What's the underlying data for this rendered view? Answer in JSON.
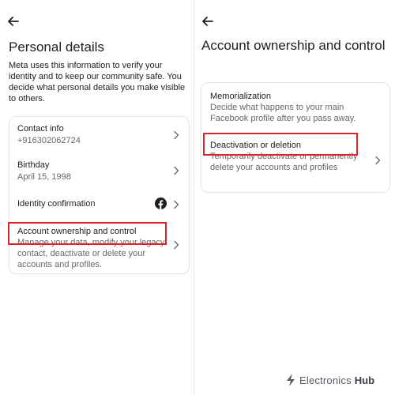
{
  "left_panel": {
    "title": "Personal details",
    "description": "Meta uses this information to verify your identity and to keep our community safe. You decide what personal details you make visible to others.",
    "items": [
      {
        "title": "Contact info",
        "subtitle": "+916302062724"
      },
      {
        "title": "Birthday",
        "subtitle": "April 15, 1998"
      },
      {
        "title": "Identity confirmation",
        "icon": "facebook-icon"
      },
      {
        "title": "Account ownership and control",
        "subtitle": "Manage your data, modify your legacy contact, deactivate or delete your accounts and profiles.",
        "highlighted": true
      }
    ]
  },
  "right_panel": {
    "title": "Account ownership and control",
    "items": [
      {
        "title": "Memorialization",
        "subtitle": "Decide what happens to your main Facebook profile after you pass away."
      },
      {
        "title": "Deactivation or deletion",
        "subtitle": "Temporarily deactivate or permanently delete your accounts and profiles",
        "highlighted": true
      }
    ]
  },
  "watermark": {
    "text_light": "Electronics",
    "text_bold": "Hub"
  },
  "colors": {
    "highlight": "#d9262c",
    "facebook": "#1c1e21",
    "secondary_text": "#65676b"
  }
}
